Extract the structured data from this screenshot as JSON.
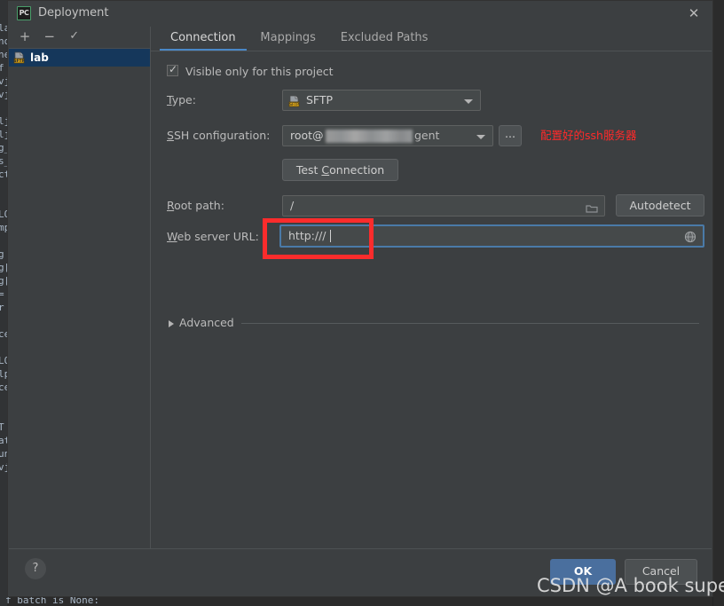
{
  "window": {
    "title": "Deployment",
    "app_icon": "PC",
    "close_icon": "✕"
  },
  "left_panel": {
    "toolbar": [
      {
        "name": "add",
        "glyph": "+"
      },
      {
        "name": "remove",
        "glyph": "−"
      },
      {
        "name": "use-as-default",
        "glyph": "✓"
      }
    ],
    "items": [
      {
        "label": "lab",
        "icon": "sftp-server-icon",
        "selected": true
      }
    ]
  },
  "tabs": [
    {
      "label": "Connection",
      "active": true
    },
    {
      "label": "Mappings",
      "active": false
    },
    {
      "label": "Excluded Paths",
      "active": false
    }
  ],
  "form": {
    "visible_only_checkbox": {
      "label": "Visible only for this project",
      "checked": true
    },
    "type": {
      "label": "Type:",
      "mnemonic": "T",
      "value": "SFTP",
      "icon": "sftp-icon"
    },
    "ssh_configuration": {
      "label": "SSH configuration:",
      "mnemonic": "S",
      "value_prefix": "root@",
      "value_suffix": "gent",
      "browse_button": "...",
      "redacted": true
    },
    "test_connection_button": "Test Connection",
    "root_path": {
      "label": "Root path:",
      "mnemonic": "R",
      "value": "/",
      "browse_icon": "folder-icon"
    },
    "autodetect_button": "Autodetect",
    "web_server_url": {
      "label": "Web server URL:",
      "mnemonic": "W",
      "value": "http:///",
      "trailing_icon": "globe-icon",
      "focused": true
    },
    "advanced": {
      "label": "Advanced",
      "expanded": false
    }
  },
  "annotations": {
    "ssh_note_cn": "配置好的ssh服务器",
    "red_box_target": "web-server-url-input",
    "red_color": "#fb2c2c"
  },
  "bottom_bar": {
    "help_glyph": "?",
    "ok_label": "OK",
    "cancel_label": "Cancel"
  },
  "watermark": {
    "text": "CSDN @A book super"
  },
  "background_editor": {
    "code_fragment": "la\nno\nne\nf\nvj\nvj\n\nlj\nlj\ng_\ns_\nct\n\n\nLO\nmp\n\ng\ng[\ng[\n=\nr\n\nce\n\nLO\nlp\nce\n\n\nT\nat\nun\nvj",
    "bottom_line": "f batch is None:"
  },
  "colors": {
    "dialog_bg": "#3c3f41",
    "field_bg": "#45494a",
    "accent_tab": "#4a88c7",
    "selection": "#15375b",
    "ok_button": "#4a6f9e",
    "annotation_red": "#ff2a2a"
  }
}
